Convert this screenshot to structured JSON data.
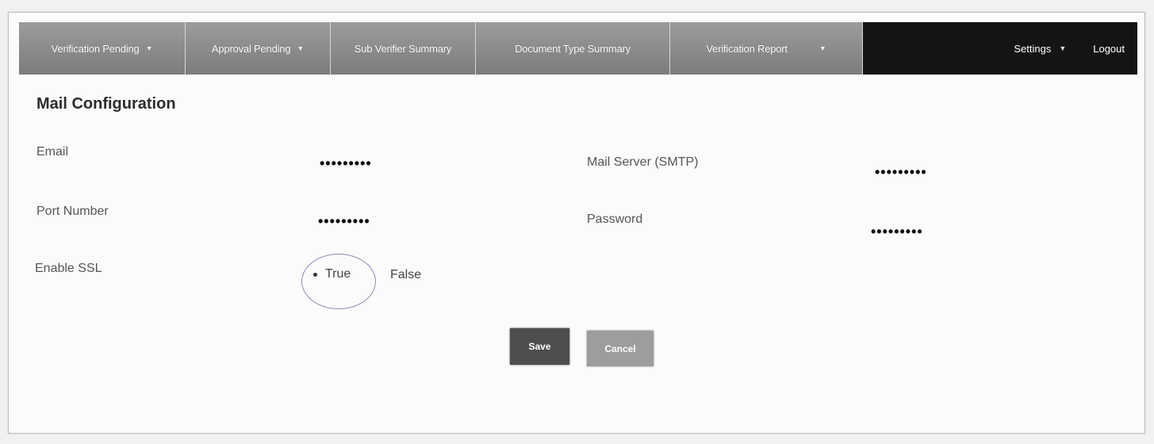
{
  "nav": {
    "items": [
      {
        "label": "Verification Pending",
        "has_dropdown": true
      },
      {
        "label": "Approval Pending",
        "has_dropdown": true
      },
      {
        "label": "Sub Verifier Summary",
        "has_dropdown": false
      },
      {
        "label": "Document Type Summary",
        "has_dropdown": false
      },
      {
        "label": "Verification Report",
        "has_dropdown": true
      }
    ],
    "settings_label": "Settings",
    "logout_label": "Logout",
    "caret": "▼"
  },
  "page": {
    "title": "Mail Configuration"
  },
  "form": {
    "email": {
      "label": "Email",
      "value": "•••••••••"
    },
    "smtp": {
      "label": "Mail Server (SMTP)",
      "value": "•••••••••"
    },
    "port": {
      "label": "Port Number",
      "value": "•••••••••"
    },
    "password": {
      "label": "Password",
      "value": "•••••••••"
    },
    "ssl": {
      "label": "Enable SSL",
      "options": [
        {
          "label": "True",
          "selected": true
        },
        {
          "label": "False",
          "selected": false
        }
      ]
    }
  },
  "buttons": {
    "save": "Save",
    "cancel": "Cancel"
  },
  "colors": {
    "nav_gray": "#8a8a8a",
    "nav_dark": "#141414",
    "save_bg": "#4e4e4e",
    "cancel_bg": "#9d9d9d"
  }
}
